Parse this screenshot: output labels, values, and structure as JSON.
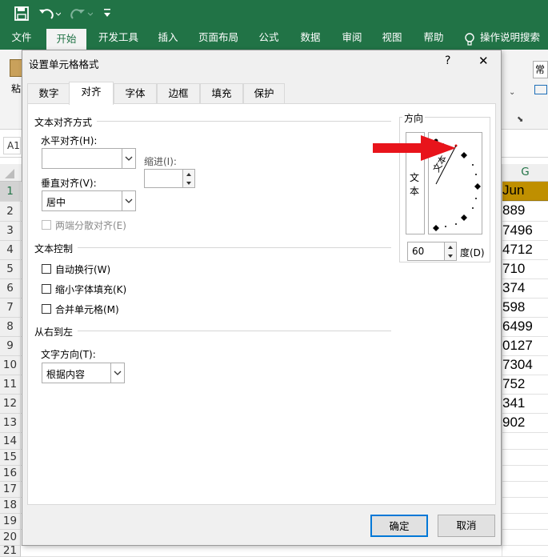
{
  "ribbon": {
    "tabs": [
      "文件",
      "开始",
      "开发工具",
      "插入",
      "页面布局",
      "公式",
      "数据",
      "审阅",
      "视图",
      "帮助"
    ],
    "active_tab": "开始",
    "tell_me": "操作说明搜索",
    "paste_label": "粘",
    "number_format": "常"
  },
  "namebox": "A1",
  "grid": {
    "rows": [
      "1",
      "2",
      "3",
      "4",
      "5",
      "6",
      "7",
      "8",
      "9",
      "10",
      "11",
      "12",
      "13",
      "14",
      "15",
      "16",
      "17",
      "18",
      "19",
      "20",
      "21"
    ],
    "col_g": "G",
    "header_cell": "Jun",
    "values": [
      "889",
      "7496",
      "4712",
      "710",
      "374",
      "598",
      "6499",
      "0127",
      "7304",
      "752",
      "341",
      "902"
    ]
  },
  "dialog": {
    "title": "设置单元格格式",
    "help": "?",
    "close": "✕",
    "tabs": [
      "数字",
      "对齐",
      "字体",
      "边框",
      "填充",
      "保护"
    ],
    "active_tab": "对齐",
    "text_alignment_section": "文本对齐方式",
    "horizontal_label": "水平对齐(H):",
    "horizontal_value": "",
    "indent_label": "缩进(I):",
    "indent_value": "",
    "vertical_label": "垂直对齐(V):",
    "vertical_value": "居中",
    "justify_distributed": "两端分散对齐(E)",
    "text_control_section": "文本控制",
    "wrap_text": "自动换行(W)",
    "shrink_to_fit": "缩小字体填充(K)",
    "merge_cells": "合并单元格(M)",
    "rtl_section": "从右到左",
    "text_direction_label": "文字方向(T):",
    "text_direction_value": "根据内容",
    "orientation_section": "方向",
    "vertical_text": "文本",
    "rotated_text": "文本",
    "degrees_value": "60",
    "degrees_label": "度(D)",
    "ok": "确定",
    "cancel": "取消"
  },
  "colors": {
    "excel_green": "#217346",
    "header_fill": "#bf8f00",
    "arrow": "#e8141b",
    "primary_border": "#0078d7"
  }
}
